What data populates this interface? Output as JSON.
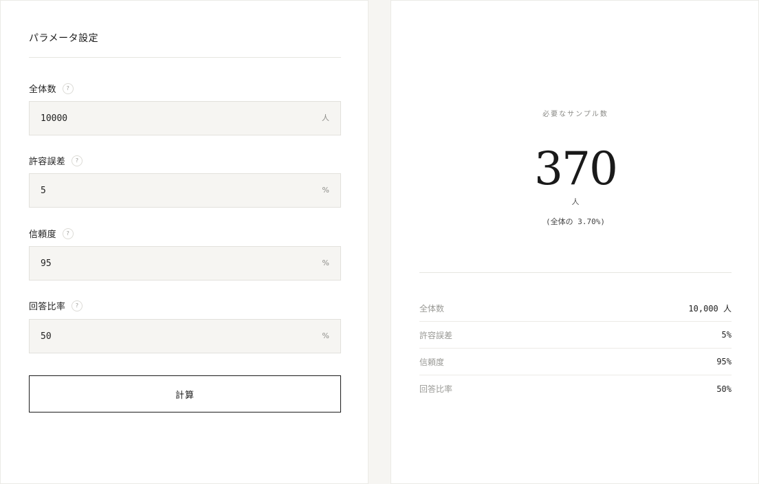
{
  "settings": {
    "title": "パラメータ設定",
    "fields": [
      {
        "label": "全体数",
        "help": "?",
        "value": "10000",
        "unit": "人"
      },
      {
        "label": "許容誤差",
        "help": "?",
        "value": "5",
        "unit": "%"
      },
      {
        "label": "信頼度",
        "help": "?",
        "value": "95",
        "unit": "%"
      },
      {
        "label": "回答比率",
        "help": "?",
        "value": "50",
        "unit": "%"
      }
    ],
    "calc_label": "計算"
  },
  "result": {
    "label": "必要なサンプル数",
    "value": "370",
    "unit": "人",
    "ratio": "(全体の 3.70%)",
    "summary": [
      {
        "key": "全体数",
        "value": "10,000 人"
      },
      {
        "key": "許容誤差",
        "value": "5%"
      },
      {
        "key": "信頼度",
        "value": "95%"
      },
      {
        "key": "回答比率",
        "value": "50%"
      }
    ]
  }
}
